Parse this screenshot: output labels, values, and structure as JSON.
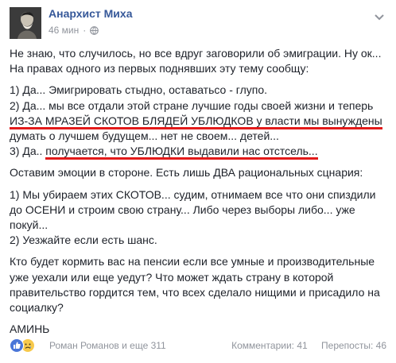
{
  "post": {
    "author": "Анархист Миха",
    "time": "46 мин",
    "separator": "·",
    "paragraphs": {
      "p1_l1": "Не знаю, что случилось, но все вдруг заговорили об эмиграции. Ну ок...",
      "p1_l2": "На правах одного из первых поднявших эту тему сообщу:",
      "p2_l1": "1) Да... Эмигрировать стыдно, оставатьсо - глупо.",
      "p2_l2": "2) Да... мы все отдали этой стране лучшие годы своей жизни и теперь",
      "p2_l3": "ИЗ-ЗА МРАЗЕЙ СКОТОВ БЛЯДЕЙ УБЛЮДКОВ у власти мы вынуждены",
      "p2_l4": "думать о лучшем будущем... нет не своем... детей...",
      "p2_l5a": "3) Да.. ",
      "p2_l5b": "получается, что УБЛЮДКИ выдавили нас отстсель...",
      "p3_l1": "Оставим эмоции в стороне. Есть лишь ДВА рациональных сцнария:",
      "p4_l1": "1) Мы убираем этих СКОТОВ... судим, отнимаем все что они спиздили",
      "p4_l2": "до ОСЕНИ и строим свою страну... Либо через выборы либо... уже",
      "p4_l3": "покуй...",
      "p4_l4": "2) Уезжайте если есть шанс.",
      "p5_l1": "Кто будет кормить вас на пенсии если все умные и производительные",
      "p5_l2": "уже уехали или еще уедут? Что может ждать страну в которой",
      "p5_l3": "правительство гордится тем, что всех сделало нищими и присадило на",
      "p5_l4": "социалку?",
      "p6_l1": "АМИНЬ"
    },
    "underline_color": "#e21a1a"
  },
  "footer": {
    "reactions": [
      "like-icon",
      "sad-icon"
    ],
    "likers": "Роман Романов и еще 311",
    "comments": "Комментарии: 41",
    "shares": "Перепосты: 46"
  },
  "colors": {
    "author": "#365899",
    "meta": "#90949c",
    "text": "#1d2129"
  }
}
